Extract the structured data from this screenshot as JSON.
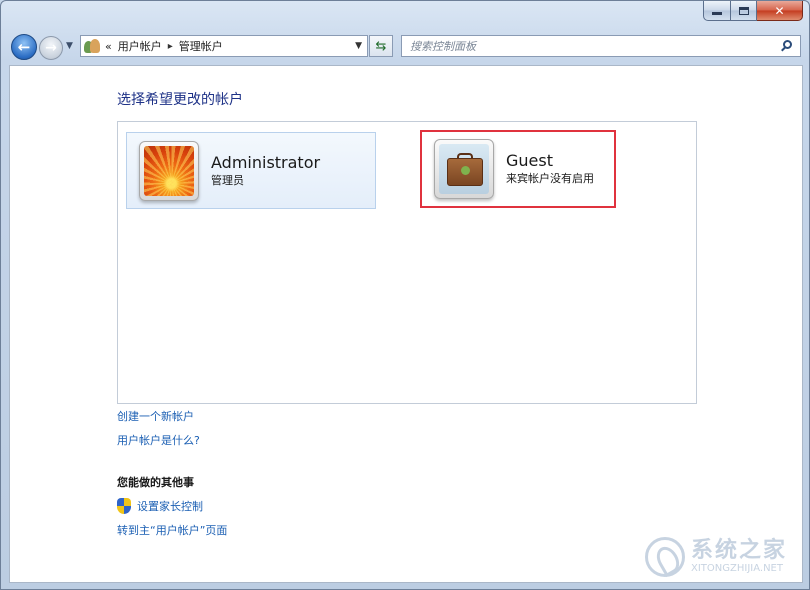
{
  "window": {
    "caption": {
      "minimize": "minimize-icon",
      "maximize": "maximize-icon",
      "close": "✕"
    }
  },
  "nav": {
    "back_icon": "back-arrow-icon",
    "forward_icon": "forward-arrow-icon",
    "recent_icon": "chevron-down-icon"
  },
  "address": {
    "overflow": "«",
    "crumbs": [
      "用户帐户",
      "管理帐户"
    ],
    "separator": "▸"
  },
  "search": {
    "placeholder": "搜索控制面板"
  },
  "page": {
    "title": "选择希望更改的帐户",
    "accounts": [
      {
        "name": "Administrator",
        "role": "管理员",
        "avatar": "flower-avatar-icon",
        "highlighted": false
      },
      {
        "name": "Guest",
        "role": "来宾帐户没有启用",
        "avatar": "suitcase-avatar-icon",
        "highlighted": true
      }
    ],
    "links": {
      "create": "创建一个新帐户",
      "what": "用户帐户是什么?"
    },
    "other": {
      "heading": "您能做的其他事",
      "parental": "设置家长控制",
      "main": "转到主“用户帐户”页面"
    }
  },
  "colors": {
    "link": "#1b5fb3",
    "title": "#1e3287",
    "highlight": "#e0323e"
  },
  "watermark": {
    "cn": "系统之家",
    "en": "XITONGZHIJIA.NET"
  }
}
